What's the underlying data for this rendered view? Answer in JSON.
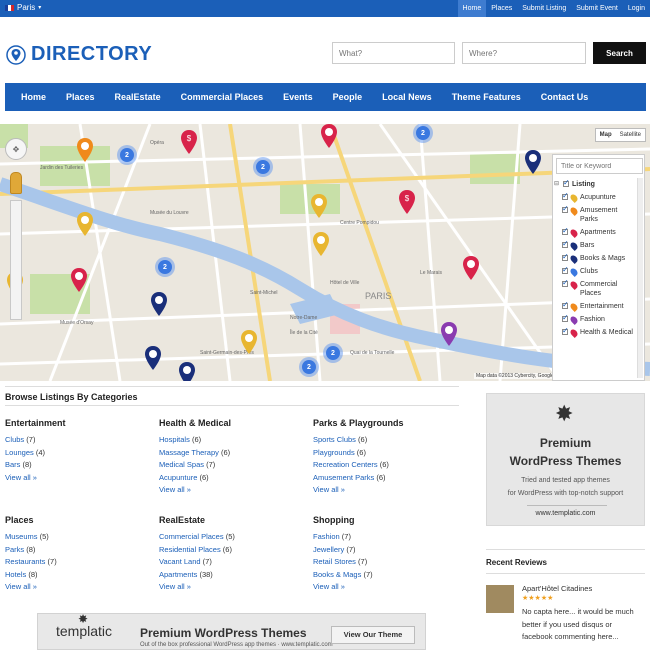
{
  "topbar": {
    "city": "Paris",
    "links": [
      "Home",
      "Places",
      "Submit Listing",
      "Submit Event",
      "Login"
    ]
  },
  "header": {
    "logo_text": "DIRECTORY",
    "search_what_placeholder": "What?",
    "search_where_placeholder": "Where?",
    "search_button": "Search"
  },
  "nav": [
    "Home",
    "Places",
    "RealEstate",
    "Commercial Places",
    "Events",
    "People",
    "Local News",
    "Theme Features",
    "Contact Us"
  ],
  "map": {
    "type_map": "Map",
    "type_satellite": "Satellite",
    "copyright": "Map data ©2013 Cybercity, Google",
    "district_label": "PARIS",
    "street_labels": [
      "Opéra",
      "Jardin des Tuileries",
      "Musée du Louvre",
      "Le Marais",
      "Centre Pompidou",
      "Musée d'Orsay",
      "Saint-Germain-des-Prés",
      "Saint-Michel",
      "Notre-Dame",
      "Île de la Cité",
      "Quai de la Tournelle",
      "Hôtel de Ville"
    ],
    "clusters": [
      "2",
      "2",
      "2",
      "2",
      "2",
      "2"
    ],
    "filter_placeholder": "Title or Keyword",
    "filter_items": [
      "Listing",
      "Acupunture",
      "Amusement Parks",
      "Apartments",
      "Bars",
      "Books & Mags",
      "Clubs",
      "Commercial Places",
      "Entertainment",
      "Fashion",
      "Health & Medical"
    ]
  },
  "categories_title": "Browse Listings By Categories",
  "categories": [
    {
      "name": "Entertainment",
      "items": [
        {
          "label": "Clubs",
          "count": "(7)"
        },
        {
          "label": "Lounges",
          "count": "(4)"
        },
        {
          "label": "Bars",
          "count": "(8)"
        }
      ],
      "more": "View all »"
    },
    {
      "name": "Health & Medical",
      "items": [
        {
          "label": "Hospitals",
          "count": "(6)"
        },
        {
          "label": "Massage Therapy",
          "count": "(6)"
        },
        {
          "label": "Medical Spas",
          "count": "(7)"
        },
        {
          "label": "Acupunture",
          "count": "(6)"
        }
      ],
      "more": "View all »"
    },
    {
      "name": "Parks & Playgrounds",
      "items": [
        {
          "label": "Sports Clubs",
          "count": "(6)"
        },
        {
          "label": "Playgrounds",
          "count": "(6)"
        },
        {
          "label": "Recreation Centers",
          "count": "(6)"
        },
        {
          "label": "Amusement Parks",
          "count": "(6)"
        }
      ],
      "more": "View all »"
    },
    {
      "name": "Places",
      "items": [
        {
          "label": "Museums",
          "count": "(5)"
        },
        {
          "label": "Parks",
          "count": "(8)"
        },
        {
          "label": "Restaurants",
          "count": "(7)"
        },
        {
          "label": "Hotels",
          "count": "(8)"
        }
      ],
      "more": "View all »"
    },
    {
      "name": "RealEstate",
      "items": [
        {
          "label": "Commercial Places",
          "count": "(5)"
        },
        {
          "label": "Residential Places",
          "count": "(6)"
        },
        {
          "label": "Vacant Land",
          "count": "(7)"
        },
        {
          "label": "Apartments",
          "count": "(38)"
        }
      ],
      "more": "View all »"
    },
    {
      "name": "Shopping",
      "items": [
        {
          "label": "Fashion",
          "count": "(7)"
        },
        {
          "label": "Jewellery",
          "count": "(7)"
        },
        {
          "label": "Retail Stores",
          "count": "(7)"
        },
        {
          "label": "Books & Mags",
          "count": "(7)"
        }
      ],
      "more": "View all »"
    }
  ],
  "sidebar_ad": {
    "line1": "Premium",
    "line2": "WordPress Themes",
    "line3": "Tried and tested app themes",
    "line4": "for WordPress with top-notch support",
    "url": "www.templatic.com"
  },
  "recent_reviews": {
    "title": "Recent Reviews",
    "item": {
      "name": "Apart'Hôtel Citadines",
      "stars": "★★★★★",
      "text": "No capta here... it would be much better if you used disqus or facebook commenting here..."
    }
  },
  "banner": {
    "brand": "templatic",
    "headline": "Premium WordPress Themes",
    "sub": "Out of the box professional WordPress app themes",
    "url": "www.templatic.com",
    "button": "View Our Theme"
  },
  "colors": {
    "brand_blue": "#1b5fb8",
    "river": "#a7c4e8",
    "park": "#c5dfa5",
    "road": "#ffffff",
    "major_road": "#f6d67a"
  }
}
